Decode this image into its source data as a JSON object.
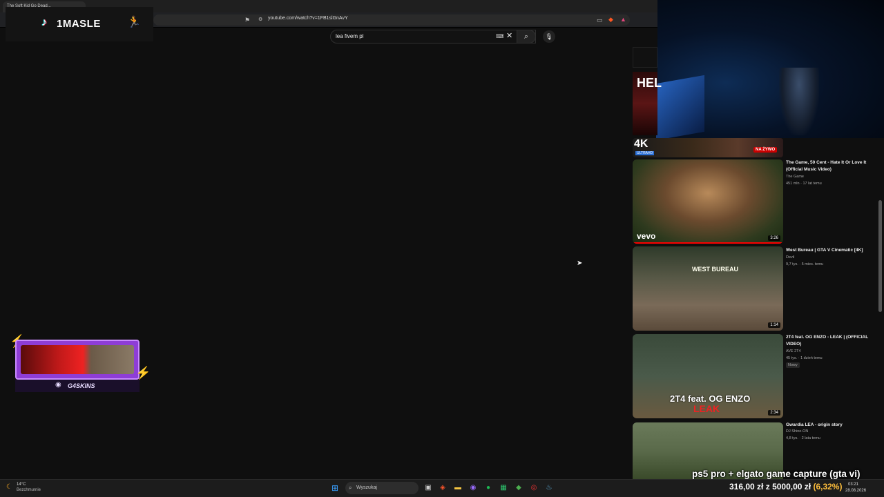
{
  "browser": {
    "tab_title": "The Soft Kid Go Dead... ",
    "url": "youtube.com/watch?v=1FB1slGnAvY"
  },
  "search": {
    "query": "lea fivem pl"
  },
  "overlay": {
    "logo_text": "1MASLE",
    "skins_text": "G4SKINS",
    "stream_title": "ps5 pro + elgato game capture (gta vi)",
    "goal_current": "316,00 zł",
    "goal_separator": "z",
    "goal_target": "5000,00 zł",
    "goal_percent": "(6,32%)",
    "goal_fraction": 0.0632
  },
  "sidebar": {
    "videos": [
      {
        "title": "The Game, 50 Cent - Hate It Or Love It (Official Music Video)",
        "channel": "The Game",
        "views": "451 mln",
        "age": "17 lat temu",
        "duration": "3:26",
        "thumb_label": "vevo"
      },
      {
        "title": "West Bureau | GTA V Cinematic [4K]",
        "channel": "Devil",
        "views": "9,7 tys.",
        "age": "5 mies. temu",
        "duration": "1:14",
        "thumb_label": "WEST BUREAU"
      },
      {
        "title": "2T4 feat. OG ENZO - LEAK | (OFFICIAL VIDEO)",
        "channel": "AVE 2T4",
        "views": "45 tys.",
        "age": "1 dzień temu",
        "badge": "Nowy",
        "duration": "2:34",
        "thumb_label": "2T4 feat. OG ENZO",
        "thumb_label2": "LEAK"
      },
      {
        "title": "Gwardia LEA - origin story",
        "channel": "DJ Shine-ON",
        "views": "4,8 tys.",
        "age": "2 lata temu"
      }
    ],
    "top_thumb": {
      "label_4k": "4K",
      "label_uhd": "ULTRAHD",
      "label_hel": "HEL",
      "live": "NA ŻYWO"
    }
  },
  "taskbar": {
    "search_placeholder": "Wyszukaj",
    "weather_temp": "14°C",
    "weather_desc": "Bezchmurnie",
    "time": "03:21",
    "date": "28.08.2026"
  },
  "colors": {
    "background": "#0f0f0f",
    "accent_red": "#ff0000",
    "skins_purple": "#8e3dd6"
  }
}
